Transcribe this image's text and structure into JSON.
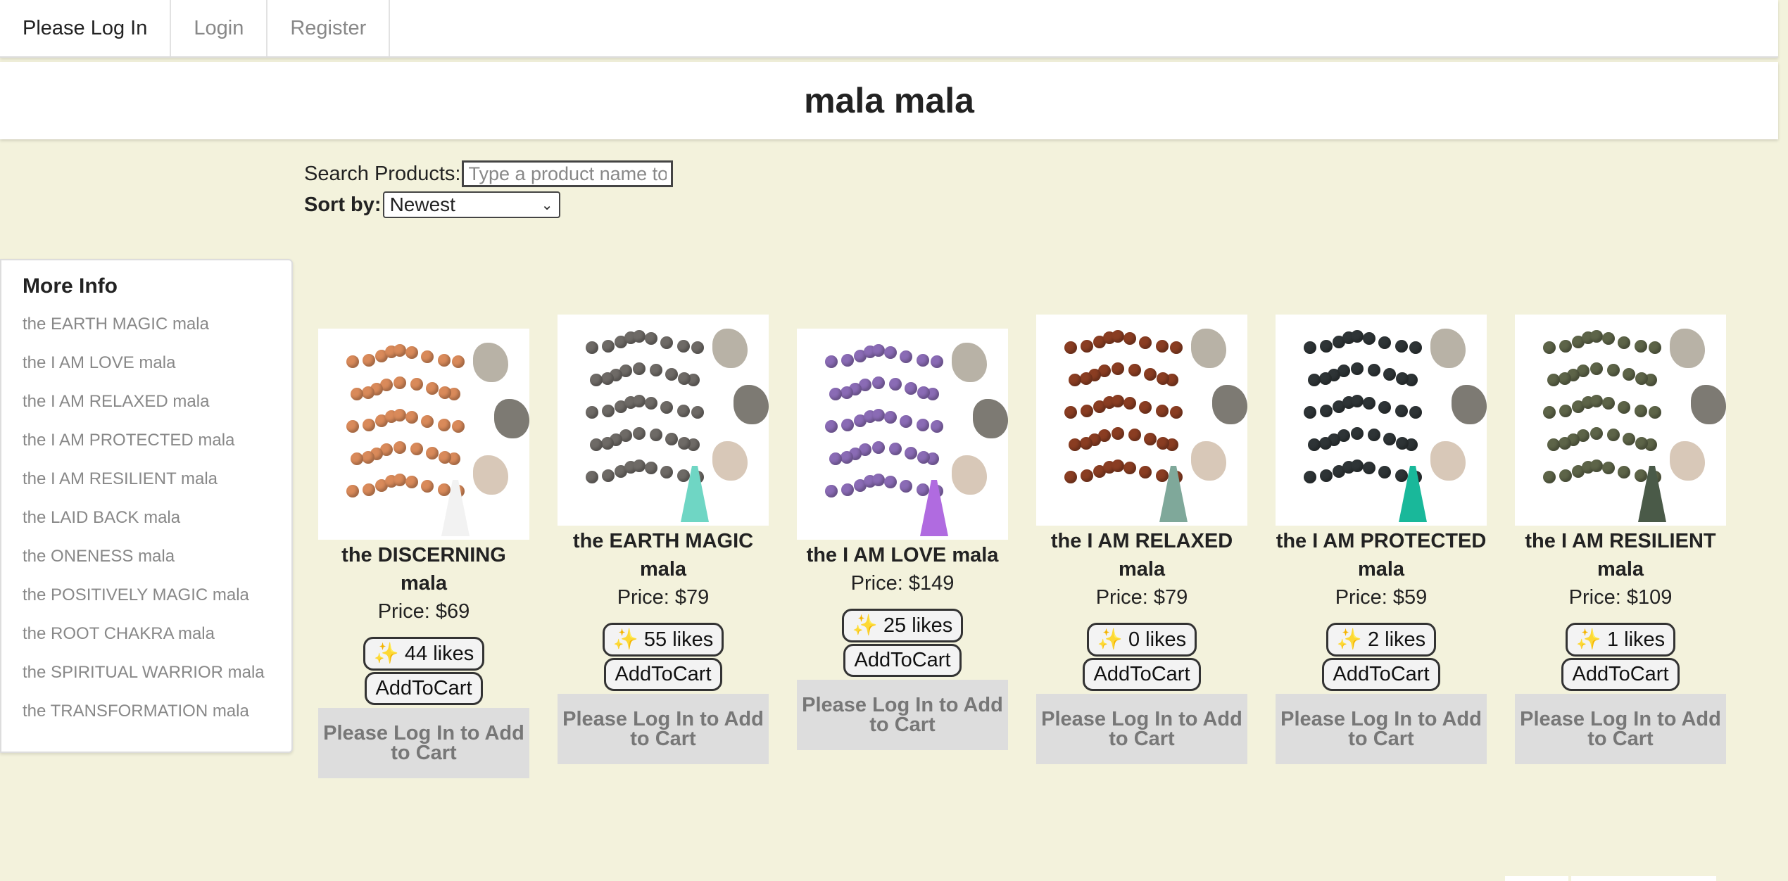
{
  "nav": {
    "brand": "Please Log In",
    "login": "Login",
    "register": "Register"
  },
  "header": {
    "title": "mala mala"
  },
  "search": {
    "label": "Search Products:",
    "placeholder": "Type a product name to"
  },
  "sort": {
    "label": "Sort by:",
    "value": "Newest"
  },
  "sidebar": {
    "title": "More Info",
    "items": [
      "the EARTH MAGIC mala",
      "the I AM LOVE mala",
      "the I AM RELAXED mala",
      "the I AM PROTECTED mala",
      "the I AM RESILIENT mala",
      "the LAID BACK mala",
      "the ONENESS mala",
      "the POSITIVELY MAGIC mala",
      "the ROOT CHAKRA mala",
      "the SPIRITUAL WARRIOR mala",
      "the TRANSFORMATION mala"
    ]
  },
  "products": [
    {
      "name": "the DISCERNING mala",
      "price": "Price: $69",
      "likes": "✨ 44 likes",
      "cart": "AddToCart",
      "login_cart": "Please Log In to Add to Cart",
      "bead_color": "#d98a5a",
      "tassel_color": "#f2f2f2"
    },
    {
      "name": "the EARTH MAGIC mala",
      "price": "Price: $79",
      "likes": "✨ 55 likes",
      "cart": "AddToCart",
      "login_cart": "Please Log In to Add to Cart",
      "bead_color": "#6e6a66",
      "tassel_color": "#6fd6c4"
    },
    {
      "name": "the I AM LOVE mala",
      "price": "Price: $149",
      "likes": "✨ 25 likes",
      "cart": "AddToCart",
      "login_cart": "Please Log In to Add to Cart",
      "bead_color": "#8a6bb5",
      "tassel_color": "#b06be0"
    },
    {
      "name": "the I AM RELAXED mala",
      "price": "Price: $79",
      "likes": "✨ 0 likes",
      "cart": "AddToCart",
      "login_cart": "Please Log In to Add to Cart",
      "bead_color": "#8a3d22",
      "tassel_color": "#7fa89a"
    },
    {
      "name": "the I AM PROTECTED mala",
      "price": "Price: $59",
      "likes": "✨ 2 likes",
      "cart": "AddToCart",
      "login_cart": "Please Log In to Add to Cart",
      "bead_color": "#2e3436",
      "tassel_color": "#19b89a"
    },
    {
      "name": "the I AM RESILIENT mala",
      "price": "Price: $109",
      "likes": "✨ 1 likes",
      "cart": "AddToCart",
      "login_cart": "Please Log In to Add to Cart",
      "bead_color": "#5d6448",
      "tassel_color": "#4a5a48"
    }
  ]
}
